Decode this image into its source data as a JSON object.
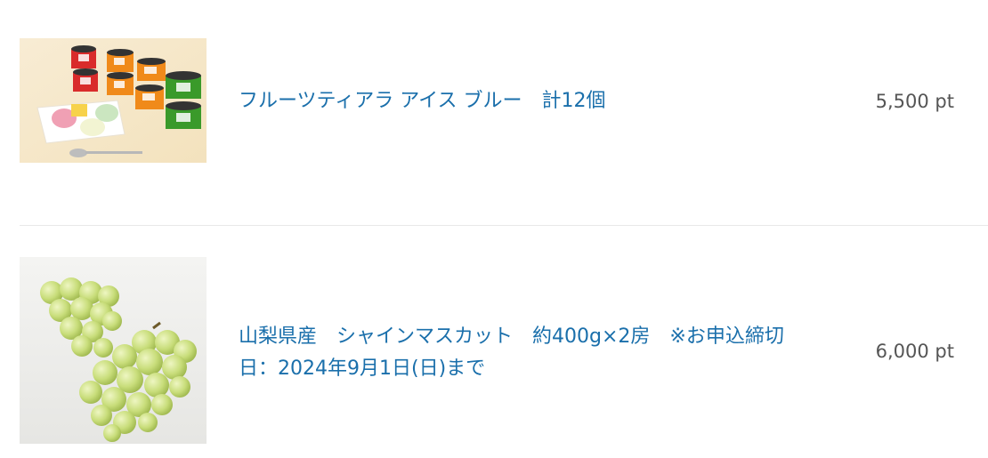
{
  "items": [
    {
      "title": "フルーツティアラ アイス ブルー　計12個",
      "price": "5,500 pt",
      "image_icon": "ice-cream-cups-photo"
    },
    {
      "title": "山梨県産　シャインマスカット　約400g×2房　※お申込締切日：2024年9月1日(日)まで",
      "price": "6,000 pt",
      "image_icon": "shine-muscat-grapes-photo"
    }
  ]
}
